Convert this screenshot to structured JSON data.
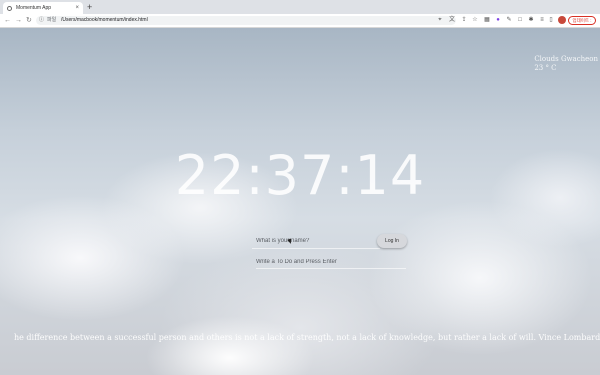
{
  "browser": {
    "tab_title": "Momentum App",
    "tab_close": "×",
    "new_tab": "+",
    "scheme_label": "파일",
    "url": "/Users/macbook/momentum/index.html",
    "update_button": "업데이트 :"
  },
  "weather": {
    "location": "Clouds Gwacheon",
    "temperature": "23 ° C"
  },
  "clock": {
    "time": "22:37:14"
  },
  "login": {
    "name_placeholder": "What is your name?",
    "button_label": "Log In"
  },
  "todo": {
    "placeholder": "Write a To Do and Press Enter"
  },
  "quote": {
    "text": "he difference between a successful person and others is not a lack of strength, not a lack of knowledge, but rather a lack of will. Vince Lombardi"
  }
}
